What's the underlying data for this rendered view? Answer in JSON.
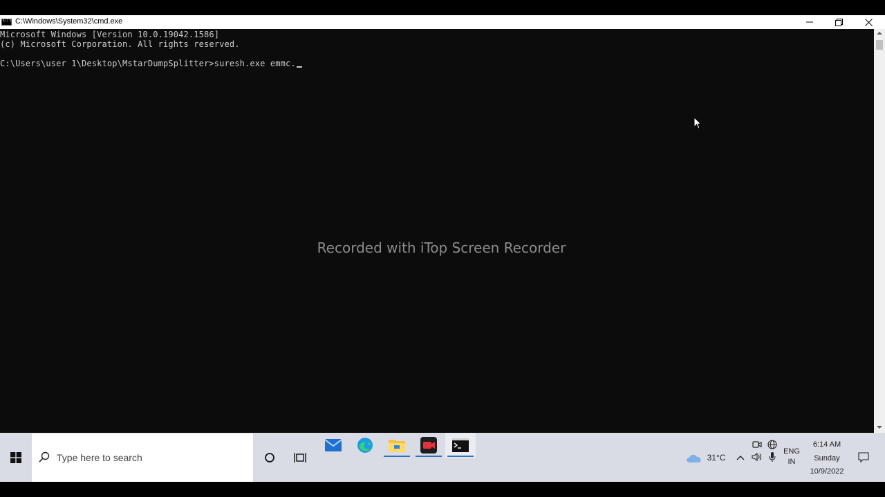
{
  "window": {
    "title": "C:\\Windows\\System32\\cmd.exe",
    "icon_text": "C:\\",
    "controls": [
      "minimize-icon",
      "restore-icon",
      "close-icon"
    ]
  },
  "console": {
    "lines": [
      "Microsoft Windows [Version 10.0.19042.1586]",
      "(c) Microsoft Corporation. All rights reserved.",
      "",
      "C:\\Users\\user 1\\Desktop\\MstarDumpSplitter>suresh.exe emmc."
    ]
  },
  "watermark": "Recorded with iTop Screen Recorder",
  "taskbar": {
    "search_placeholder": "Type here to search",
    "apps": [
      "mail-icon",
      "edge-icon",
      "file-explorer-icon",
      "screen-recorder-icon",
      "cmd-icon"
    ],
    "weather": "31°C",
    "language_line1": "ENG",
    "language_line2": "IN",
    "time": "6:14 AM",
    "day": "Sunday",
    "date": "10/9/2022"
  },
  "colors": {
    "console_bg": "#0c0c0c",
    "console_text": "#cccccc",
    "taskbar_bg": "#d9dce4",
    "accent": "#2f6fbd"
  }
}
